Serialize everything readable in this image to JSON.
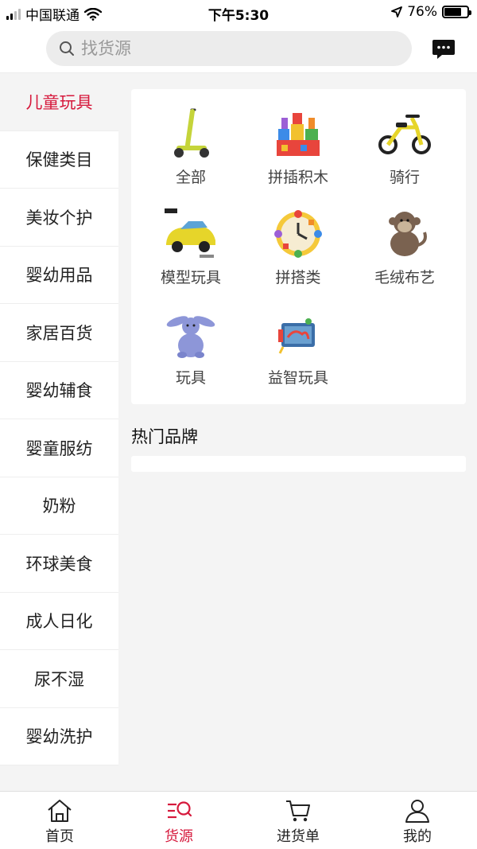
{
  "status_bar": {
    "carrier": "中国联通",
    "time": "下午5:30",
    "battery": "76%",
    "battery_level": 0.76
  },
  "search": {
    "placeholder": "找货源"
  },
  "sidebar": {
    "items": [
      {
        "label": "儿童玩具",
        "active": true
      },
      {
        "label": "保健类目"
      },
      {
        "label": "美妆个护"
      },
      {
        "label": "婴幼用品"
      },
      {
        "label": "家居百货"
      },
      {
        "label": "婴幼辅食"
      },
      {
        "label": "婴童服纺"
      },
      {
        "label": "奶粉"
      },
      {
        "label": "环球美食"
      },
      {
        "label": "成人日化"
      },
      {
        "label": "尿不湿"
      },
      {
        "label": "婴幼洗护"
      }
    ]
  },
  "categories": [
    {
      "label": "全部",
      "icon": "scooter-icon"
    },
    {
      "label": "拼插积木",
      "icon": "building-blocks-icon"
    },
    {
      "label": "骑行",
      "icon": "tricycle-icon"
    },
    {
      "label": "模型玩具",
      "icon": "toy-car-icon"
    },
    {
      "label": "拼搭类",
      "icon": "clock-puzzle-icon"
    },
    {
      "label": "毛绒布艺",
      "icon": "plush-monkey-icon"
    },
    {
      "label": "玩具",
      "icon": "plush-bunny-icon"
    },
    {
      "label": "益智玩具",
      "icon": "cloth-book-icon"
    }
  ],
  "brands": {
    "title": "热门品牌"
  },
  "tabbar": {
    "tabs": [
      {
        "label": "首页",
        "icon": "home-icon"
      },
      {
        "label": "货源",
        "icon": "source-search-icon",
        "active": true
      },
      {
        "label": "进货单",
        "icon": "cart-icon"
      },
      {
        "label": "我的",
        "icon": "user-icon"
      }
    ]
  },
  "colors": {
    "accent": "#d6193c",
    "background": "#f4f4f4"
  }
}
